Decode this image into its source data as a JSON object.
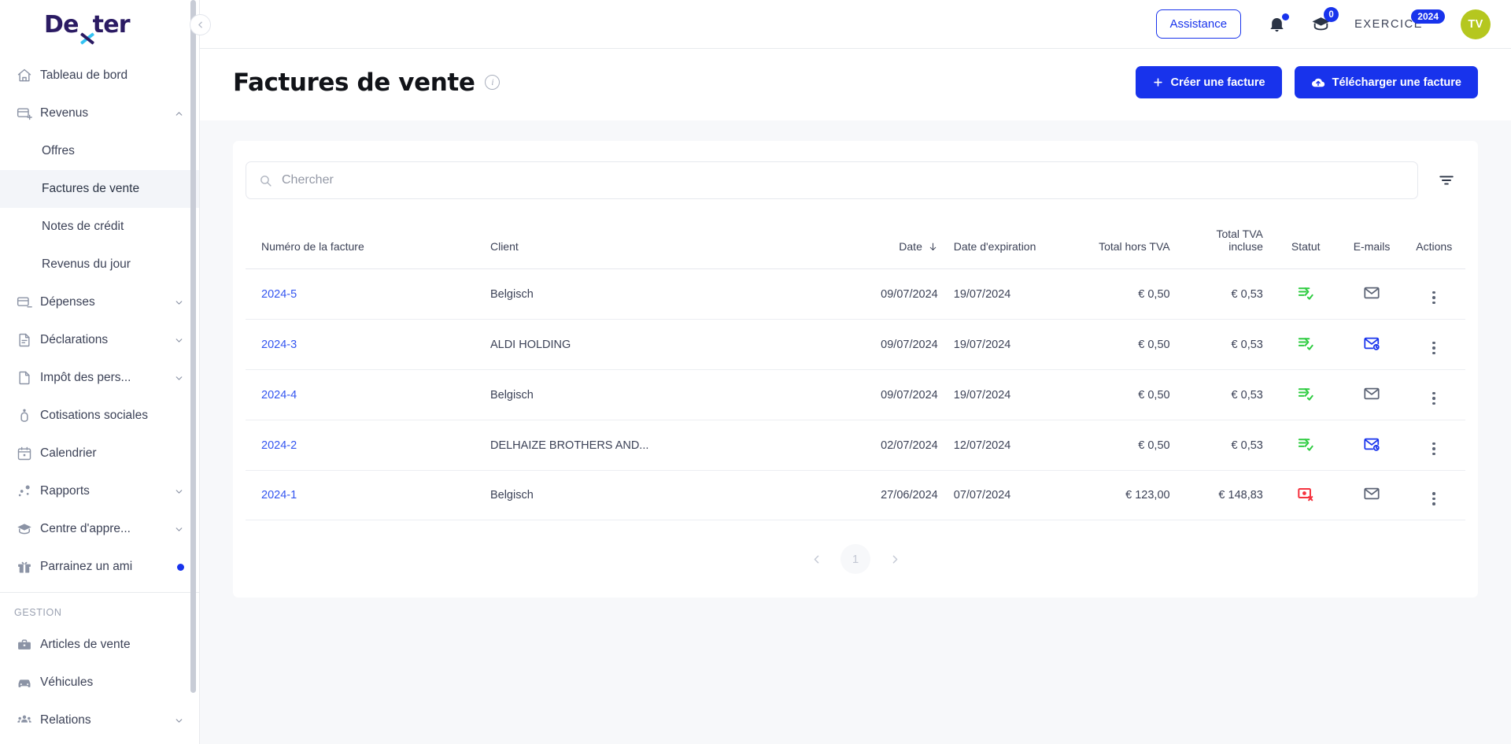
{
  "brand": {
    "logo_part1": "De",
    "logo_part2": "ter",
    "accent_color": "#1833ec",
    "logo_dark": "#2b1b63",
    "logo_cyan": "#35c3f3"
  },
  "sidebar": {
    "collapse_tooltip": "Réduire",
    "items": [
      {
        "label": "Tableau de bord",
        "icon": "home-icon",
        "type": "item",
        "chevron": false,
        "active": false
      },
      {
        "label": "Revenus",
        "icon": "revenue-card-icon",
        "type": "item",
        "chevron": "up",
        "active": false
      },
      {
        "label": "Offres",
        "icon": null,
        "type": "sub",
        "chevron": false,
        "active": false
      },
      {
        "label": "Factures de vente",
        "icon": null,
        "type": "sub",
        "chevron": false,
        "active": true
      },
      {
        "label": "Notes de crédit",
        "icon": null,
        "type": "sub",
        "chevron": false,
        "active": false
      },
      {
        "label": "Revenus du jour",
        "icon": null,
        "type": "sub",
        "chevron": false,
        "active": false
      },
      {
        "label": "Dépenses",
        "icon": "expense-card-icon",
        "type": "item",
        "chevron": "down",
        "active": false
      },
      {
        "label": "Déclarations",
        "icon": "document-lines-icon",
        "type": "item",
        "chevron": "down",
        "active": false
      },
      {
        "label": "Impôt des pers...",
        "icon": "document-icon",
        "type": "item",
        "chevron": "down",
        "active": false
      },
      {
        "label": "Cotisations sociales",
        "icon": "person-icon",
        "type": "item",
        "chevron": false,
        "active": false
      },
      {
        "label": "Calendrier",
        "icon": "calendar-icon",
        "type": "item",
        "chevron": false,
        "active": false
      },
      {
        "label": "Rapports",
        "icon": "reports-icon",
        "type": "item",
        "chevron": "down",
        "active": false
      },
      {
        "label": "Centre d'appre...",
        "icon": "graduation-cap-icon",
        "type": "item",
        "chevron": "down",
        "active": false
      },
      {
        "label": "Parrainez un ami",
        "icon": "gift-icon",
        "type": "item",
        "chevron": false,
        "active": false,
        "dot": true
      }
    ],
    "group_title": "GESTION",
    "group_items": [
      {
        "label": "Articles de vente",
        "icon": "briefcase-icon",
        "chevron": false
      },
      {
        "label": "Véhicules",
        "icon": "car-icon",
        "chevron": false
      },
      {
        "label": "Relations",
        "icon": "people-icon",
        "chevron": "down"
      }
    ]
  },
  "topbar": {
    "assistance_label": "Assistance",
    "bell_icon": "bell-icon",
    "bell_has_dot": true,
    "academy_icon": "graduation-cap-icon",
    "academy_count": "0",
    "exercice_label": "EXERCICE",
    "exercice_year": "2024",
    "avatar_initials": "TV",
    "avatar_color": "#b5c71f"
  },
  "page": {
    "title": "Factures de vente",
    "info_icon": "info-icon",
    "create_button": "Créer une facture",
    "upload_button": "Télécharger une facture"
  },
  "search": {
    "placeholder": "Chercher",
    "value": "",
    "filter_icon": "filter-icon"
  },
  "table": {
    "columns": [
      {
        "label": "Numéro de la facture",
        "align": "left"
      },
      {
        "label": "Client",
        "align": "left"
      },
      {
        "label": "Date",
        "align": "right",
        "sort": "desc"
      },
      {
        "label": "Date d'expiration",
        "align": "left"
      },
      {
        "label": "Total hors TVA",
        "align": "right"
      },
      {
        "label": "Total TVA incluse",
        "align": "right"
      },
      {
        "label": "Statut",
        "align": "center"
      },
      {
        "label": "E-mails",
        "align": "center"
      },
      {
        "label": "Actions",
        "align": "center"
      }
    ],
    "rows": [
      {
        "number": "2024-5",
        "client": "Belgisch",
        "date": "09/07/2024",
        "expiration": "19/07/2024",
        "total_excl_vat": "€ 0,50",
        "total_incl_vat": "€ 0,53",
        "status_icon": "sent-check-icon",
        "status_color": "#2ecc40",
        "email_icon": "envelope-icon",
        "email_color": "#5b6374",
        "actions_icon": "kebab-menu-icon"
      },
      {
        "number": "2024-3",
        "client": "ALDI HOLDING",
        "date": "09/07/2024",
        "expiration": "19/07/2024",
        "total_excl_vat": "€ 0,50",
        "total_incl_vat": "€ 0,53",
        "status_icon": "sent-check-icon",
        "status_color": "#2ecc40",
        "email_icon": "envelope-sync-icon",
        "email_color": "#1833ec",
        "actions_icon": "kebab-menu-icon"
      },
      {
        "number": "2024-4",
        "client": "Belgisch",
        "date": "09/07/2024",
        "expiration": "19/07/2024",
        "total_excl_vat": "€ 0,50",
        "total_incl_vat": "€ 0,53",
        "status_icon": "sent-check-icon",
        "status_color": "#2ecc40",
        "email_icon": "envelope-icon",
        "email_color": "#5b6374",
        "actions_icon": "kebab-menu-icon"
      },
      {
        "number": "2024-2",
        "client": "DELHAIZE BROTHERS AND...",
        "date": "02/07/2024",
        "expiration": "12/07/2024",
        "total_excl_vat": "€ 0,50",
        "total_incl_vat": "€ 0,53",
        "status_icon": "sent-check-icon",
        "status_color": "#2ecc40",
        "email_icon": "envelope-sync-icon",
        "email_color": "#1833ec",
        "actions_icon": "kebab-menu-icon"
      },
      {
        "number": "2024-1",
        "client": "Belgisch",
        "date": "27/06/2024",
        "expiration": "07/07/2024",
        "total_excl_vat": "€ 123,00",
        "total_incl_vat": "€ 148,83",
        "status_icon": "payment-failed-icon",
        "status_color": "#f5333f",
        "email_icon": "envelope-icon",
        "email_color": "#5b6374",
        "actions_icon": "kebab-menu-icon"
      }
    ]
  },
  "pagination": {
    "prev": "‹",
    "current": "1",
    "next": "›"
  }
}
